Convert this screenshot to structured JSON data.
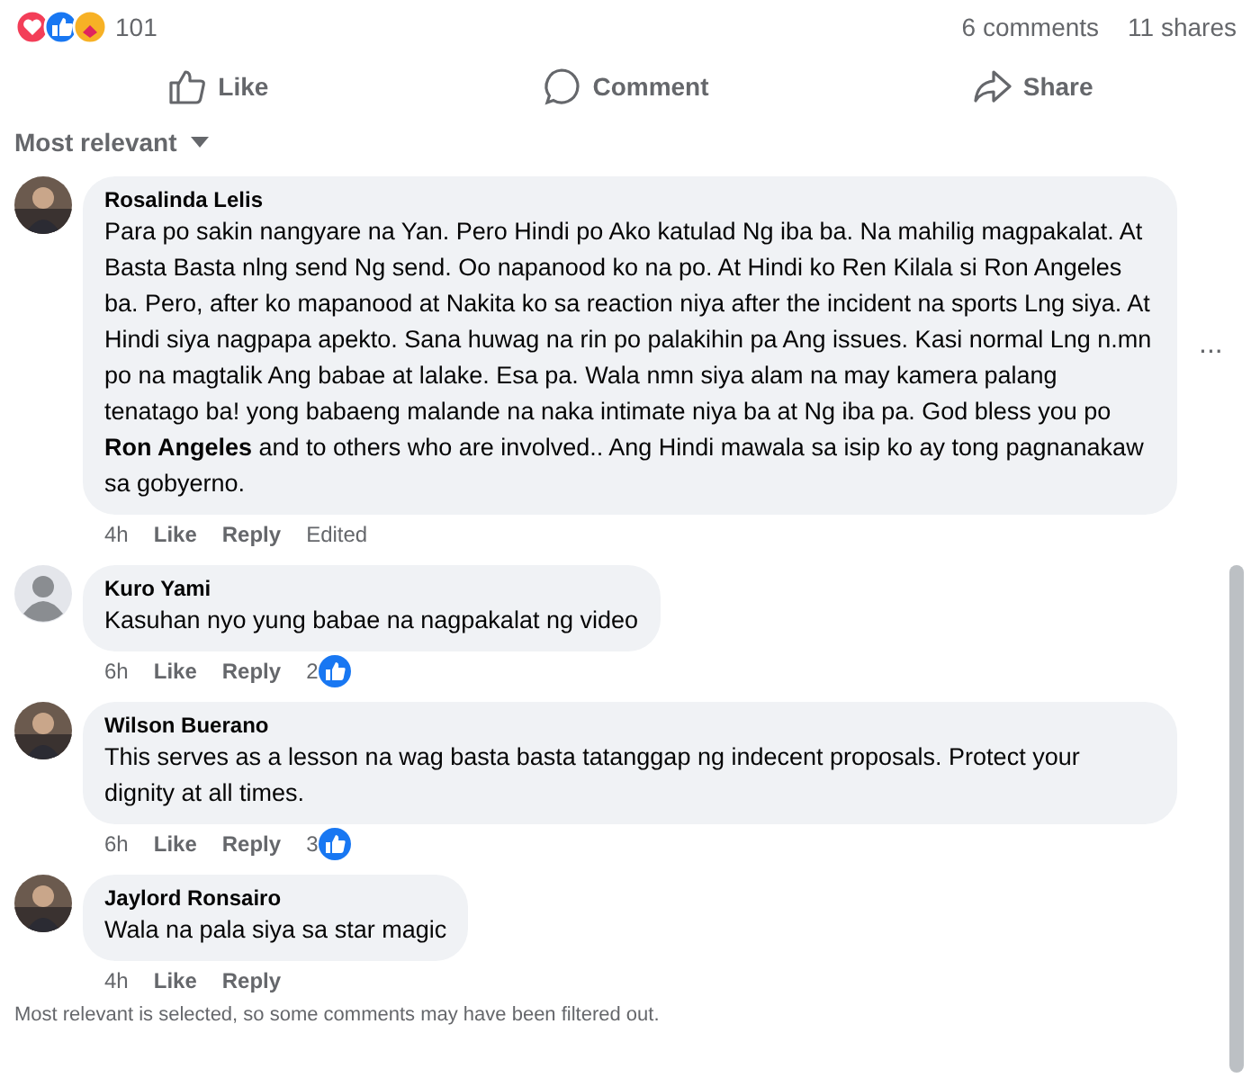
{
  "post_stats": {
    "reaction_count": "101",
    "comments": "6 comments",
    "shares": "11 shares"
  },
  "actions": [
    {
      "kind": "like",
      "label": "Like"
    },
    {
      "kind": "comment",
      "label": "Comment"
    },
    {
      "kind": "share",
      "label": "Share"
    }
  ],
  "sort": {
    "label": "Most relevant"
  },
  "comments": [
    {
      "author": "Rosalinda Lelis",
      "text": "Para po sakin nangyare na Yan. Pero Hindi po Ako katulad Ng iba ba. Na mahilig magpakalat. At Basta Basta nlng send Ng send. Oo napanood ko na po. At Hindi ko Ren Kilala si Ron Angeles ba. Pero, after ko mapanood at Nakita ko sa reaction niya after the incident na sports Lng siya. At Hindi siya nagpapa apekto. Sana huwag na rin po palakihin pa Ang issues. Kasi normal Lng n.mn po na magtalik Ang babae at lalake. Esa pa. Wala nmn siya alam na may kamera palang tenatago ba! yong babaeng malande na naka intimate niya ba at Ng iba pa. God bless you po **Ron Angeles** and to others who are involved.. Ang Hindi mawala sa isip ko ay tong pagnanakaw sa gobyerno.",
      "time": "4h",
      "like": "Like",
      "reply": "Reply",
      "edited": "Edited",
      "more_menu": "..."
    },
    {
      "author": "Kuro Yami",
      "kind": "default",
      "text": "Kasuhan nyo yung babae na nagpakalat ng video",
      "time": "6h",
      "like": "Like",
      "reply": "Reply",
      "reactions": "2"
    },
    {
      "author": "Wilson Buerano",
      "text": "This serves as a lesson na wag basta basta tatanggap ng indecent proposals. Protect your dignity at all times.",
      "time": "6h",
      "like": "Like",
      "reply": "Reply",
      "reactions": "3"
    },
    {
      "author": "Jaylord Ronsairo",
      "text": "Wala na pala siya sa star magic",
      "time": "4h",
      "like": "Like",
      "reply": "Reply"
    }
  ],
  "filter_note": "Most relevant is selected, so some comments may have been filtered out."
}
